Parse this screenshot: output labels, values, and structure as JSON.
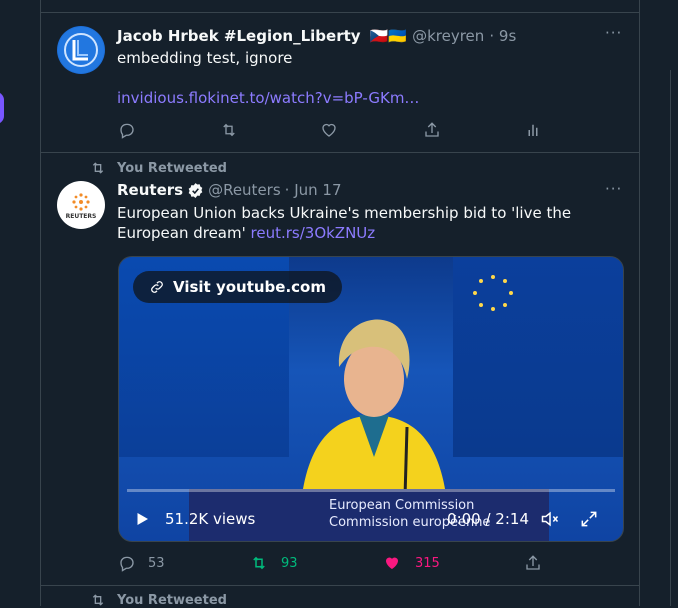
{
  "tweet1": {
    "name": "Jacob Hrbek #Legion_Liberty",
    "flags": "🇨🇿🇺🇦",
    "handle": "@kreyren",
    "time": "· 9s",
    "text": "embedding test, ignore",
    "link": "invidious.flokinet.to/watch?v=bP-GKm…",
    "more": "···"
  },
  "tweet2": {
    "retweet_label": "You Retweeted",
    "name": "Reuters",
    "handle": "@Reuters",
    "time": "· Jun 17",
    "text": "European Union backs Ukraine's membership bid to 'live the European dream'",
    "link": "reut.rs/3OkZNUz",
    "more": "···",
    "avatar_text": "REUTERS",
    "video": {
      "overlay": "Visit youtube.com",
      "views": "51.2K views",
      "time": "0:00 / 2:14",
      "caption1": "European Commission",
      "caption2": "Commission européenne",
      "counter": "1"
    },
    "actions": {
      "replies": "53",
      "retweets": "93",
      "likes": "315"
    },
    "colors": {
      "retweet": "#00ba7c",
      "like": "#f91880"
    }
  },
  "tweet3": {
    "retweet_label": "You Retweeted"
  }
}
